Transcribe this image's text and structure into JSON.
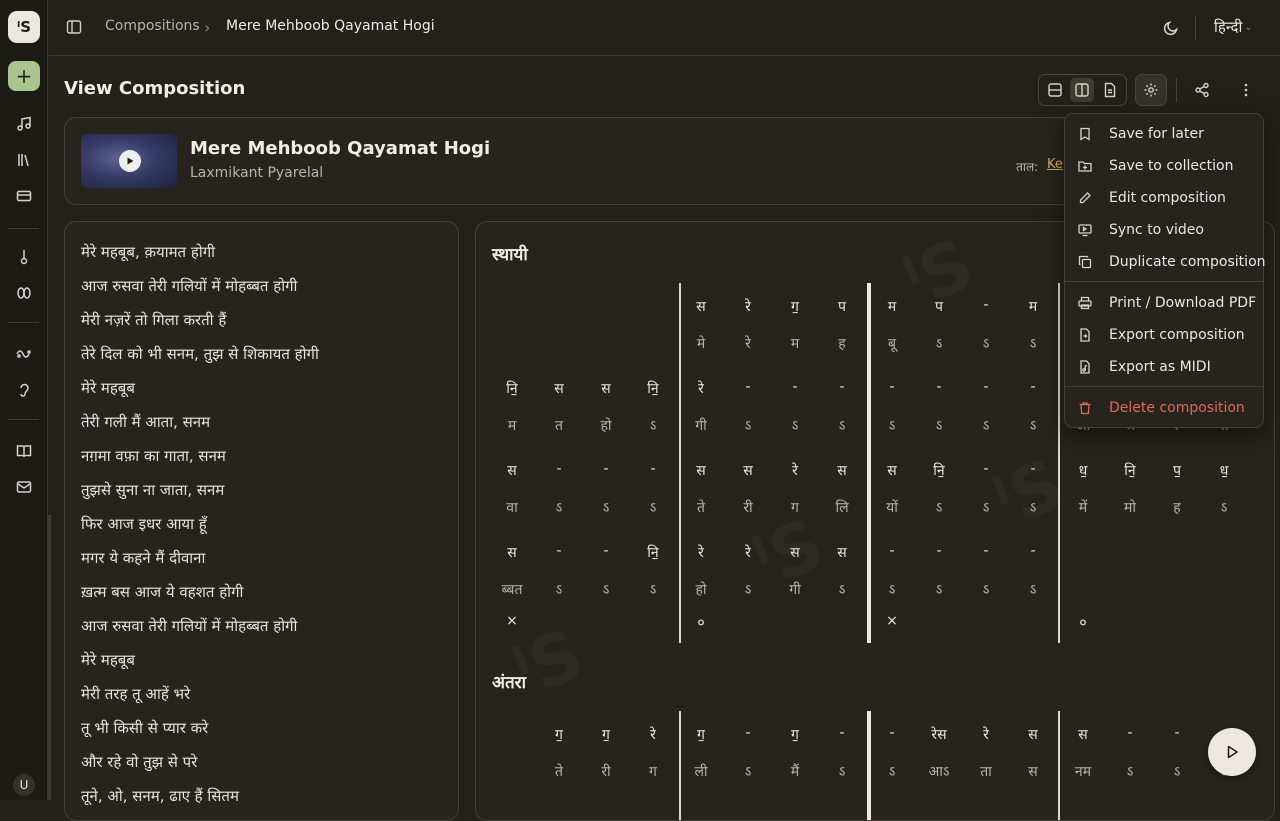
{
  "sidebar": {
    "logo_text": "ˡS",
    "user_initial": "U"
  },
  "topbar": {
    "breadcrumb_parent": "Compositions",
    "breadcrumb_separator": "›",
    "breadcrumb_current": "Mere Mehboob Qayamat Hogi",
    "language": "हिन्दी"
  },
  "page": {
    "title": "View Composition"
  },
  "song": {
    "title": "Mere Mehboob Qayamat Hogi",
    "artist": "Laxmikant Pyarelal",
    "taal_label": "ताल:",
    "taal_value": "Ke"
  },
  "lyrics": [
    "मेरे महबूब, क़यामत होगी",
    "आज रुसवा तेरी गलियों में मोहब्बत होगी",
    "मेरी नज़रें तो गिला करती हैं",
    "तेरे दिल को भी सनम, तुझ से शिकायत होगी",
    "मेरे महबूब",
    "तेरी गली मैं आता, सनम",
    "नग़मा वफ़ा का गाता, सनम",
    "तुझसे सुना ना जाता, सनम",
    "फिर आज इधर आया हूँ",
    "मगर ये कहने मैं दीवाना",
    "ख़त्म बस आज ये वहशत होगी",
    "आज रुसवा तेरी गलियों में मोहब्बत होगी",
    "मेरे महबूब",
    "मेरी तरह तू आहें भरे",
    "तू भी किसी से प्यार करे",
    "और रहे वो तुझ से परे",
    "तूने, ओ, सनम, ढाए हैं सितम"
  ],
  "notation": {
    "sthayi_title": "स्थायी",
    "antara_title": "अंतरा",
    "sthayi_rows": [
      {
        "swar": [
          "",
          "",
          "",
          "",
          "स",
          "रे",
          "ग॒",
          "प",
          "म",
          "प",
          "-",
          "म",
          "",
          "",
          "",
          ""
        ],
        "lyric": [
          "",
          "",
          "",
          "",
          "मे",
          "रे",
          "म",
          "ह",
          "बू",
          "ऽ",
          "ऽ",
          "ऽ",
          "",
          "",
          "",
          ""
        ]
      },
      {
        "swar": [
          "नि॒",
          "स",
          "स",
          "नि॒",
          "रे",
          "-",
          "-",
          "-",
          "-",
          "-",
          "-",
          "-",
          "",
          "",
          "",
          ""
        ],
        "lyric": [
          "म",
          "त",
          "हो",
          "ऽ",
          "गी",
          "ऽ",
          "ऽ",
          "ऽ",
          "ऽ",
          "ऽ",
          "ऽ",
          "ऽ",
          "आ",
          "ज",
          "रु",
          "स"
        ]
      },
      {
        "swar": [
          "स",
          "-",
          "-",
          "-",
          "स",
          "स",
          "रे",
          "स",
          "स",
          "नि॒",
          "-",
          "-",
          "ध॒",
          "नि॒",
          "प॒",
          "ध॒"
        ],
        "lyric": [
          "वा",
          "ऽ",
          "ऽ",
          "ऽ",
          "ते",
          "री",
          "ग",
          "लि",
          "यों",
          "ऽ",
          "ऽ",
          "ऽ",
          "में",
          "मो",
          "ह",
          "ऽ"
        ]
      },
      {
        "swar": [
          "स",
          "-",
          "-",
          "नि॒",
          "रे",
          "रे",
          "स",
          "स",
          "-",
          "-",
          "-",
          "-",
          "",
          "",
          "",
          ""
        ],
        "lyric": [
          "ब्बत",
          "ऽ",
          "ऽ",
          "ऽ",
          "हो",
          "ऽ",
          "गी",
          "ऽ",
          "ऽ",
          "ऽ",
          "ऽ",
          "ऽ",
          "",
          "",
          "",
          ""
        ]
      }
    ],
    "taal_marks": [
      "×",
      "०",
      "×",
      "०"
    ],
    "antara_rows": [
      {
        "swar": [
          "",
          "ग॒",
          "ग॒",
          "रे",
          "ग॒",
          "-",
          "ग॒",
          "-",
          "-",
          "रेस",
          "रे",
          "स",
          "स",
          "-",
          "-",
          ""
        ],
        "lyric": [
          "",
          "ते",
          "री",
          "ग",
          "ली",
          "ऽ",
          "मैं",
          "ऽ",
          "ऽ",
          "आऽ",
          "ता",
          "स",
          "नम",
          "ऽ",
          "ऽ",
          "ऽ"
        ]
      }
    ]
  },
  "menu": {
    "items": [
      {
        "label": "Save for later",
        "icon": "bookmark-icon"
      },
      {
        "label": "Save to collection",
        "icon": "folder-plus-icon"
      },
      {
        "label": "Edit composition",
        "icon": "pencil-icon"
      },
      {
        "label": "Sync to video",
        "icon": "monitor-play-icon"
      },
      {
        "label": "Duplicate composition",
        "icon": "copy-icon"
      },
      {
        "label": "Print / Download PDF",
        "icon": "printer-icon"
      },
      {
        "label": "Export composition",
        "icon": "file-export-icon"
      },
      {
        "label": "Export as MIDI",
        "icon": "file-music-icon"
      },
      {
        "label": "Delete composition",
        "icon": "trash-icon"
      }
    ]
  }
}
